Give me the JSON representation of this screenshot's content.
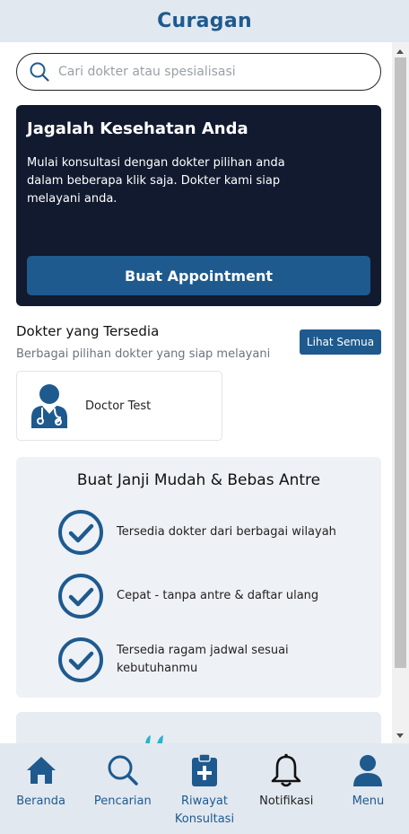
{
  "header": {
    "title": "Curagan"
  },
  "search": {
    "placeholder": "Cari dokter atau spesialisasi",
    "value": ""
  },
  "hero": {
    "title": "Jagalah Kesehatan Anda",
    "text": "Mulai konsultasi dengan dokter pilihan anda dalam beberapa klik saja. Dokter kami siap melayani anda.",
    "button_label": "Buat Appointment"
  },
  "doctors_section": {
    "title": "Dokter yang Tersedia",
    "subtitle": "Berbagai pilihan dokter yang siap melayani",
    "see_all_label": "Lihat Semua",
    "doctors": [
      {
        "name": "Doctor Test"
      }
    ]
  },
  "promo": {
    "title": "Buat Janji Mudah & Bebas Antre",
    "features": [
      {
        "text": "Tersedia dokter dari berbagai wilayah"
      },
      {
        "text": "Cepat - tanpa antre & daftar ulang"
      },
      {
        "text": "Tersedia ragam jadwal sesuai kebutuhanmu"
      }
    ]
  },
  "bottom_nav": {
    "items": [
      {
        "label": "Beranda",
        "icon": "home-icon"
      },
      {
        "label": "Pencarian",
        "icon": "search-icon"
      },
      {
        "label": "Riwayat Konsultasi",
        "icon": "clipboard-medical-icon"
      },
      {
        "label": "Notifikasi",
        "icon": "bell-icon"
      },
      {
        "label": "Menu",
        "icon": "user-icon"
      }
    ]
  },
  "colors": {
    "brand": "#1e5a8e",
    "hero_bg": "#111a2e",
    "bar_bg": "#e2e8f0",
    "promo_bg": "#eef1f6"
  }
}
